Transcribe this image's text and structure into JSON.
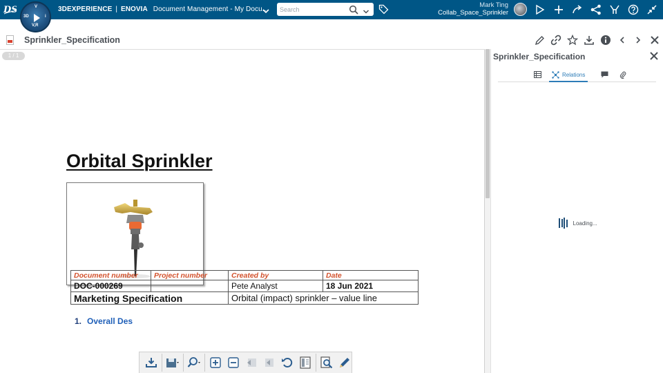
{
  "topbar": {
    "brand_prefix": "3DEXPERIENCE",
    "brand_separator": "|",
    "brand_product": "ENOVIA",
    "app_title": "Document Management - My Docu...",
    "search_placeholder": "Search",
    "user_name": "Mark Ting",
    "collab_space": "Collab_Space_Sprinkler",
    "compass_labels": {
      "top": "V",
      "left": "3D",
      "right": "i",
      "bottom": "V,R"
    },
    "icons": [
      "ds-logo-icon",
      "compass-icon",
      "chevron-down-icon",
      "search-icon",
      "tag-icon",
      "avatar",
      "share-icon",
      "add-icon",
      "forward-icon",
      "network-icon",
      "collaborate-icon",
      "help-icon",
      "collapse-icon"
    ],
    "colors": {
      "bar": "#005686",
      "text": "#ffffff"
    }
  },
  "document": {
    "title": "Sprinkler_Specification",
    "page_indicator": "1 / 1",
    "heading": "Orbital Sprinkler",
    "table": {
      "headers": [
        "Document number",
        "Project number",
        "Created by",
        "Date"
      ],
      "row1": [
        "DOC-000269",
        "",
        "Pete Analyst",
        "18 Jun 2021"
      ],
      "row2": [
        "Marketing Specification",
        "Orbital (impact) sprinkler – value line"
      ]
    },
    "section_number": "1.",
    "section_title": "Overall Des",
    "header_color": "#d2522d",
    "section_color": "#1f5fb8"
  },
  "doc_actions": [
    "edit-icon",
    "link-icon",
    "star-icon",
    "download-icon",
    "info-icon",
    "prev-icon",
    "next-icon",
    "close-icon"
  ],
  "viewer_toolbar": [
    "download-icon",
    "save-icon",
    "zoom-icon",
    "zoom-in-icon",
    "zoom-out-icon",
    "first-page-icon",
    "prev-page-icon",
    "rotate-icon",
    "fit-page-icon",
    "find-icon",
    "annotate-icon"
  ],
  "panel": {
    "title": "Sprinkler_Specification",
    "tabs": [
      {
        "icon": "properties-icon",
        "label": ""
      },
      {
        "icon": "relations-icon",
        "label": "Relations"
      },
      {
        "icon": "comments-icon",
        "label": ""
      },
      {
        "icon": "attachment-icon",
        "label": ""
      }
    ],
    "active_tab": "Relations",
    "loading_text": "Loading..."
  }
}
